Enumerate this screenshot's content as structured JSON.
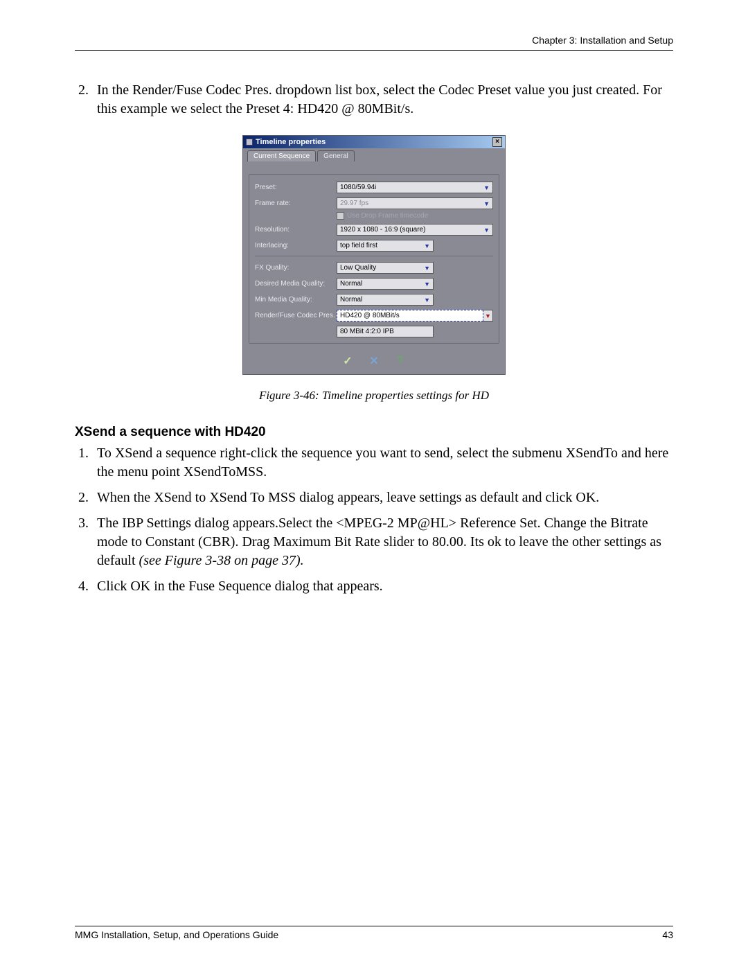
{
  "header": {
    "chapter": "Chapter 3: Installation and Setup"
  },
  "intro_step": {
    "number": "2.",
    "text": "In the Render/Fuse Codec Pres. dropdown list box, select the Codec Preset value you just created. For this example we select the Preset 4: HD420 @ 80MBit/s."
  },
  "dialog": {
    "title": "Timeline properties",
    "tabs": {
      "current": "Current Sequence",
      "general": "General"
    },
    "fields": {
      "preset_label": "Preset:",
      "preset_value": "1080/59.94i",
      "framerate_label": "Frame rate:",
      "framerate_value": "29.97 fps",
      "dropframe_label": "Use Drop Frame timecode",
      "resolution_label": "Resolution:",
      "resolution_value": "1920 x 1080 - 16:9 (square)",
      "interlacing_label": "Interlacing:",
      "interlacing_value": "top field first",
      "fxq_label": "FX Quality:",
      "fxq_value": "Low Quality",
      "dmq_label": "Desired Media Quality:",
      "dmq_value": "Normal",
      "mmq_label": "Min Media Quality:",
      "mmq_value": "Normal",
      "codec_label": "Render/Fuse Codec Pres.",
      "codec_value": "HD420 @ 80MBit/s",
      "codec_sub": "80 MBit 4:2:0 IPB"
    }
  },
  "figure_caption": "Figure 3-46: Timeline properties settings for HD",
  "section_heading": "XSend a sequence with HD420",
  "steps": [
    {
      "n": "1.",
      "t": "To XSend a sequence right-click the sequence you want to send, select the submenu XSendTo and here the menu point XSendToMSS."
    },
    {
      "n": "2.",
      "t": "When the XSend to XSend To MSS dialog appears, leave settings as default and click OK."
    },
    {
      "n": "3.",
      "t_pre": "The IBP Settings dialog appears.Select the <MPEG-2 MP@HL> Reference Set. Change the Bitrate mode to Constant (CBR). Drag Maximum Bit Rate slider to 80.00. Its ok to leave the other settings as default ",
      "t_ital": "(see Figure 3-38 on page 37)."
    },
    {
      "n": "4.",
      "t": "Click OK in the Fuse Sequence dialog that appears."
    }
  ],
  "footer": {
    "left": "MMG Installation, Setup, and Operations Guide",
    "right": "43"
  }
}
